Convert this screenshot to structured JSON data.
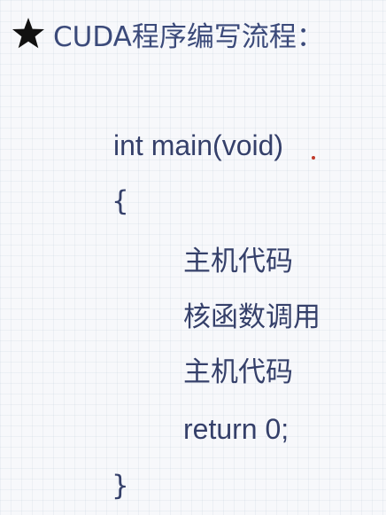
{
  "title": {
    "icon": "star-icon",
    "text": "CUDA程序编写流程："
  },
  "code": {
    "lines": [
      "int main(void)",
      "{",
      "主机代码",
      "核函数调用",
      "主机代码",
      "return 0;",
      "}"
    ]
  },
  "colors": {
    "text": "#35406a",
    "title": "#3b4a7a",
    "star": "#111111",
    "pointer_dot": "#c0392b",
    "background": "#f7f8fb"
  }
}
